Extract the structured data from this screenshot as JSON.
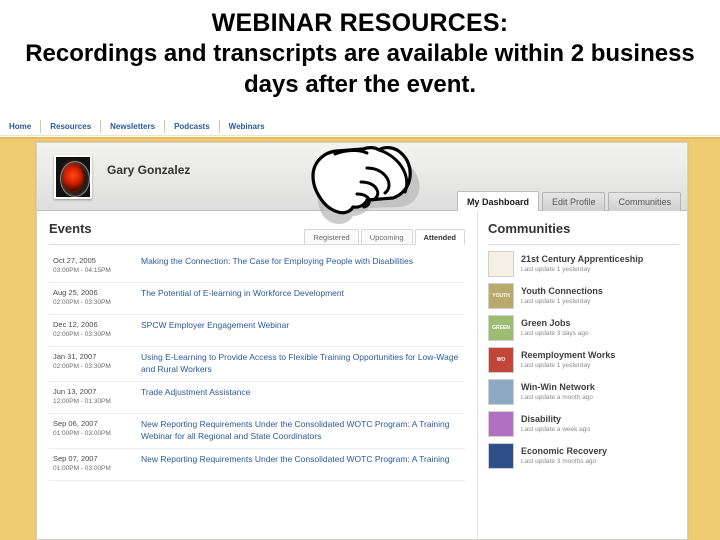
{
  "headline": {
    "line1": "WEBINAR RESOURCES:",
    "line2": "Recordings and transcripts are available within 2 business days after the event."
  },
  "site_nav": {
    "items": [
      {
        "label": "Home"
      },
      {
        "label": "Resources"
      },
      {
        "label": "Newsletters"
      },
      {
        "label": "Podcasts"
      },
      {
        "label": "Webinars"
      }
    ]
  },
  "profile": {
    "user_name": "Gary Gonzalez",
    "avatar_icon": "hal-red-eye-avatar",
    "tabs": [
      {
        "label": "My Dashboard",
        "active": true
      },
      {
        "label": "Edit Profile",
        "active": false
      },
      {
        "label": "Communities",
        "active": false
      }
    ]
  },
  "cursor": {
    "icon": "pointing-hand-cursor"
  },
  "events": {
    "title": "Events",
    "tabs": [
      {
        "label": "Registered",
        "active": false
      },
      {
        "label": "Upcoming",
        "active": false
      },
      {
        "label": "Attended",
        "active": true
      }
    ],
    "rows": [
      {
        "date": "Oct 27, 2005",
        "time": "03:00PM - 04:15PM",
        "title": "Making the Connection: The Case for Employing People with Disabilities"
      },
      {
        "date": "Aug 25, 2006",
        "time": "02:00PM - 03:30PM",
        "title": "The Potential of E-learning in Workforce Development"
      },
      {
        "date": "Dec 12, 2006",
        "time": "02:00PM - 03:30PM",
        "title": "SPCW Employer Engagement Webinar"
      },
      {
        "date": "Jan 31, 2007",
        "time": "02:00PM - 03:30PM",
        "title": "Using E-Learning to Provide Access to Flexible Training Opportunities for Low-Wage and Rural Workers"
      },
      {
        "date": "Jun 13, 2007",
        "time": "12:00PM - 01:30PM",
        "title": "Trade Adjustment Assistance"
      },
      {
        "date": "Sep 06, 2007",
        "time": "01:00PM - 03:00PM",
        "title": "New Reporting Requirements Under the Consolidated WOTC Program: A Training Webinar for all Regional and State Coordinators"
      },
      {
        "date": "Sep 07, 2007",
        "time": "01:00PM - 03:00PM",
        "title": "New Reporting Requirements Under the Consolidated WOTC Program: A Training"
      }
    ]
  },
  "communities": {
    "title": "Communities",
    "rows": [
      {
        "name": "21st Century Apprenticeship",
        "update": "Last update 1 yesterday",
        "icon_label": "",
        "icon_color": "#f4f0e6",
        "icon_name": "community-icon-apprenticeship"
      },
      {
        "name": "Youth Connections",
        "update": "Last update 1 yesterday",
        "icon_label": "YOUTH",
        "icon_color": "#b9a96a",
        "icon_name": "community-icon-youth"
      },
      {
        "name": "Green Jobs",
        "update": "Last update 3 days ago",
        "icon_label": "GREEN",
        "icon_color": "#9dbb72",
        "icon_name": "community-icon-green-jobs"
      },
      {
        "name": "Reemployment Works",
        "update": "Last update 1 yesterday",
        "icon_label": "WO",
        "icon_color": "#c2453a",
        "icon_name": "community-icon-reemployment"
      },
      {
        "name": "Win-Win Network",
        "update": "Last update a month ago",
        "icon_label": "",
        "icon_color": "#8fa8c4",
        "icon_name": "community-icon-win-win"
      },
      {
        "name": "Disability",
        "update": "Last update a week ago",
        "icon_label": "",
        "icon_color": "#b36fc0",
        "icon_name": "community-icon-disability"
      },
      {
        "name": "Economic Recovery",
        "update": "Last update 3 months ago",
        "icon_label": "",
        "icon_color": "#2f4f8a",
        "icon_name": "community-icon-economic-recovery"
      }
    ]
  },
  "colors": {
    "page_band": "#efcc72",
    "link_blue": "#2b5a9b",
    "nav_blue": "#2b5a9b"
  }
}
